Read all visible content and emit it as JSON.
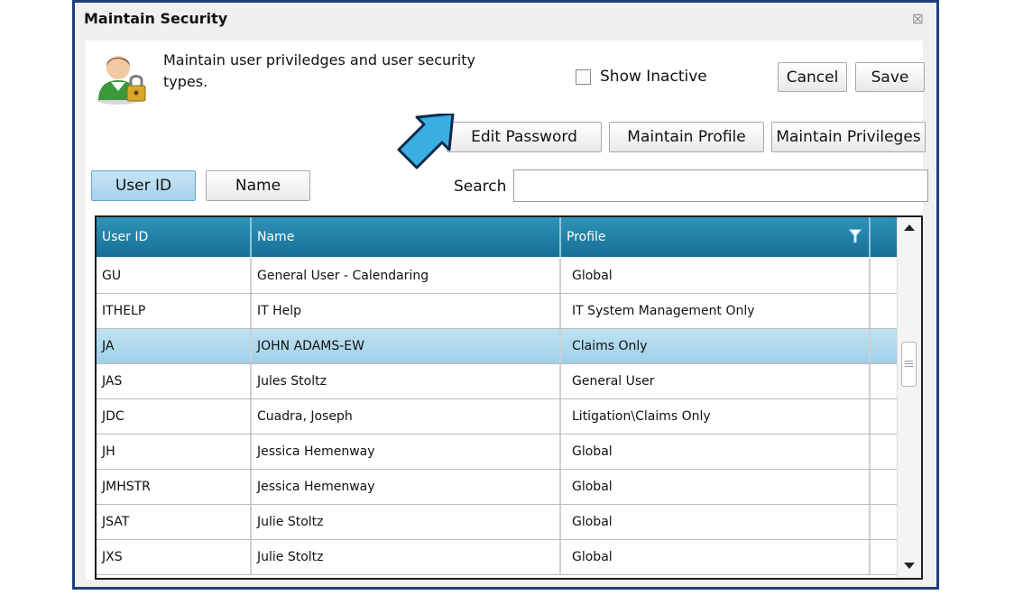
{
  "window": {
    "title": "Maintain Security",
    "close_glyph": "⊠"
  },
  "header": {
    "description": "Maintain user priviledges and user security types.",
    "show_inactive_label": "Show Inactive",
    "show_inactive_checked": false,
    "cancel_label": "Cancel",
    "save_label": "Save"
  },
  "actions": {
    "edit_password_label": "Edit Password",
    "maintain_profile_label": "Maintain Profile",
    "maintain_privileges_label": "Maintain Privileges"
  },
  "sort_toggle": {
    "user_id_label": "User ID",
    "name_label": "Name",
    "active": "user_id"
  },
  "search": {
    "label": "Search",
    "value": ""
  },
  "grid": {
    "columns": [
      "User ID",
      "Name",
      "Profile"
    ],
    "rows": [
      {
        "user_id": "GU",
        "name": "General User - Calendaring",
        "profile": "Global"
      },
      {
        "user_id": "ITHELP",
        "name": "IT Help",
        "profile": "IT System Management Only"
      },
      {
        "user_id": "JA",
        "name": "JOHN ADAMS-EW",
        "profile": "Claims Only",
        "selected": true
      },
      {
        "user_id": "JAS",
        "name": "Jules Stoltz",
        "profile": "General User"
      },
      {
        "user_id": "JDC",
        "name": "Cuadra, Joseph",
        "profile": "Litigation\\Claims Only"
      },
      {
        "user_id": "JH",
        "name": "Jessica Hemenway",
        "profile": "Global"
      },
      {
        "user_id": "JMHSTR",
        "name": "Jessica Hemenway",
        "profile": "Global"
      },
      {
        "user_id": "JSAT",
        "name": "Julie Stoltz",
        "profile": "Global"
      },
      {
        "user_id": "JXS",
        "name": "Julie Stoltz",
        "profile": "Global"
      }
    ]
  },
  "icons": {
    "user": "user-lock-icon",
    "filter": "filter-icon",
    "arrow": "pointer-arrow-icon"
  },
  "colors": {
    "header_blue": "#1f7fa8",
    "selection_blue": "#a7d2ec",
    "arrow_blue": "#3aaee3",
    "frame_navy": "#1f3f7a"
  }
}
